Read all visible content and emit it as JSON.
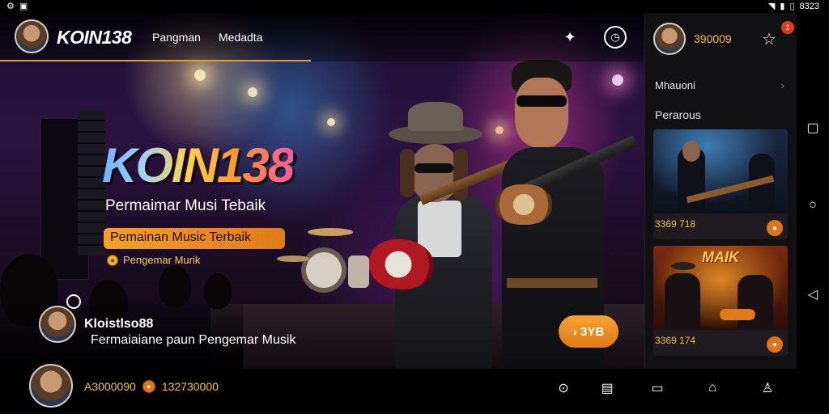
{
  "statusbar": {
    "left_icons": [
      "settings-icon",
      "lock-icon"
    ],
    "time": "8323"
  },
  "header": {
    "brand": "KOIN138",
    "nav": [
      "Pangman",
      "Medadta"
    ],
    "icons": [
      "puzzle-icon",
      "clock-icon"
    ]
  },
  "hero": {
    "logo": "KOIN138",
    "tagline": "Permaimar Musi Tebaik",
    "highlight": "Pemainan Music Terbaik",
    "fans_label": "Pengemar Murik",
    "profile_name": "Kloistlso88",
    "profile_sub": "Fermaiaiane paun Pengemar Musik",
    "play_button": "› 3YB"
  },
  "panel": {
    "username": "390009",
    "notification_count": "1",
    "menu_row": "Mhauoni",
    "section_title": "Perarous",
    "cards": [
      {
        "value": "3369 718"
      },
      {
        "value": "3369 174",
        "poster_text": "MAIK"
      }
    ]
  },
  "bottombar": {
    "balance": "A3000090",
    "coins": "132730000",
    "icons": [
      "download-icon",
      "gallery-icon",
      "document-icon",
      "home-icon",
      "profile-icon"
    ]
  },
  "colors": {
    "accent": "#e0a030",
    "gold": "#f5c23a",
    "orange": "#e07a18",
    "panel_bg": "#111013"
  }
}
